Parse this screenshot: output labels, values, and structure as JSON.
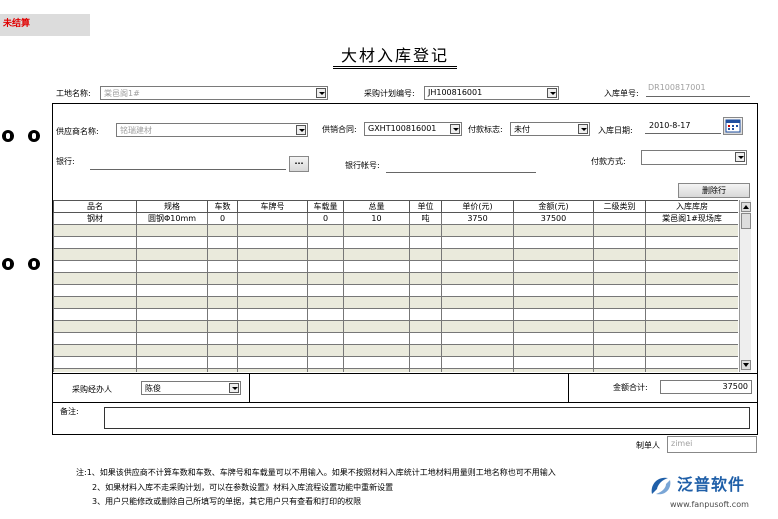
{
  "status": "未结算",
  "title": "大材入库登记",
  "top_row": {
    "site_label": "工地名称:",
    "site_value": "棠邑阁1#",
    "plan_label": "采购计划编号:",
    "plan_value": "JH100816001",
    "receipt_label": "入库单号:",
    "receipt_value": "DR100817001"
  },
  "supplier_row": {
    "supplier_label": "供应商名称:",
    "supplier_value": "铭瑞建材",
    "contract_label": "供销合同:",
    "contract_value": "GXHT100816001",
    "payment_flag_label": "付款标志:",
    "payment_flag_value": "未付",
    "date_label": "入库日期:",
    "date_value": "2010-8-17"
  },
  "bank_row": {
    "bank_label": "银行:",
    "bank_button": "···",
    "account_label": "银行帐号:",
    "pay_method_label": "付款方式:"
  },
  "delete_row_button": "删除行",
  "grid": {
    "columns": [
      "品名",
      "规格",
      "车数",
      "车牌号",
      "车载量",
      "总量",
      "单位",
      "单价(元)",
      "金额(元)",
      "二级类别",
      "入库库房"
    ],
    "rows": [
      [
        "钢材",
        "圆钢Φ10mm",
        "0",
        "",
        "0",
        "10",
        "吨",
        "3750",
        "37500",
        "",
        "棠邑阁1#现场库"
      ]
    ],
    "empty_rows": 13
  },
  "footer": {
    "purchaser_label": "采购经办人",
    "purchaser_value": "陈俊",
    "total_label": "金额合计:",
    "total_value": "37500",
    "remark_label": "备注:"
  },
  "maker": {
    "label": "制单人",
    "value": "zimei"
  },
  "notes": [
    "注:1、如果该供应商不计算车数和车数、车牌号和车载量可以不用输入。如果不按照材料入库统计工地材料用量则工地名称也可不用输入",
    "2、如果材料入库不走采购计划，可以在参数设置》材料入库流程设置功能中重新设置",
    "3、用户只能修改或删除自己所填写的单据，其它用户只有查看和打印的权限"
  ],
  "logo": {
    "name": "泛普软件",
    "url": "www.fanpusoft.com"
  },
  "colors": {
    "status_red": "#e00000",
    "logo_blue": "#1f5fa8",
    "grid_alt": "#eaeadc"
  }
}
